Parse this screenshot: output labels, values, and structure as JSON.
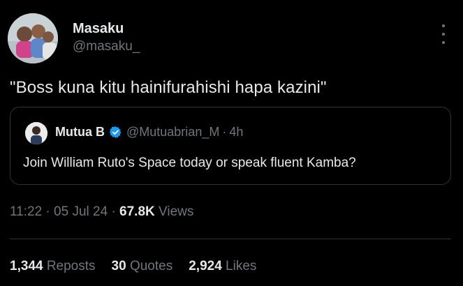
{
  "author": {
    "name": "Masaku",
    "handle": "@masaku_"
  },
  "tweet": {
    "text": "\"Boss kuna kitu hainifurahishi hapa kazini\""
  },
  "quoted": {
    "name": "Mutua B",
    "handle": "@Mutuabrian_M",
    "separator": "·",
    "time": "4h",
    "text": "Join William Ruto's Space today or speak fluent Kamba?",
    "verified_color": "#1d9bf0"
  },
  "meta": {
    "time": "11:22",
    "separator": "·",
    "date": "05 Jul 24",
    "views_count": "67.8K",
    "views_label": "Views"
  },
  "stats": {
    "reposts_count": "1,344",
    "reposts_label": "Reposts",
    "quotes_count": "30",
    "quotes_label": "Quotes",
    "likes_count": "2,924",
    "likes_label": "Likes"
  },
  "icons": [
    "more-vertical-icon",
    "verified-badge-icon"
  ]
}
